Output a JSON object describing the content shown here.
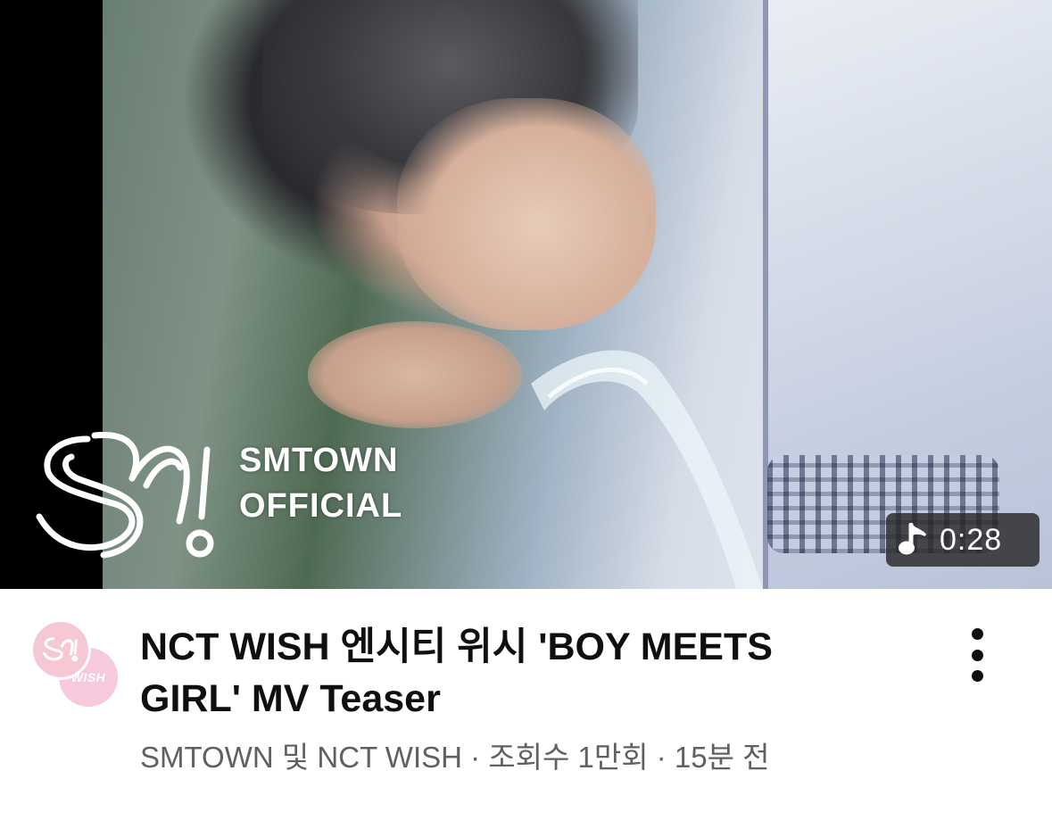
{
  "video": {
    "thumbnail_overlay": {
      "brand_line1": "SMTOWN",
      "brand_line2": "OFFICIAL"
    },
    "duration": "0:28",
    "duration_icon": "music-note-icon",
    "title": "NCT WISH 엔시티 위시 'BOY MEETS GIRL' MV Teaser",
    "meta": "SMTOWN 및 NCT WISH · 조회수 1만회 · 15분 전",
    "avatar_secondary_text": "WISH"
  },
  "colors": {
    "background": "#ffffff",
    "title_text": "#0f0f0f",
    "meta_text": "#606060",
    "duration_badge": "#282828",
    "avatar_pink": "#f5c8d4"
  },
  "icons": [
    "sm-logo-icon",
    "music-note-icon",
    "more-vertical-icon"
  ]
}
